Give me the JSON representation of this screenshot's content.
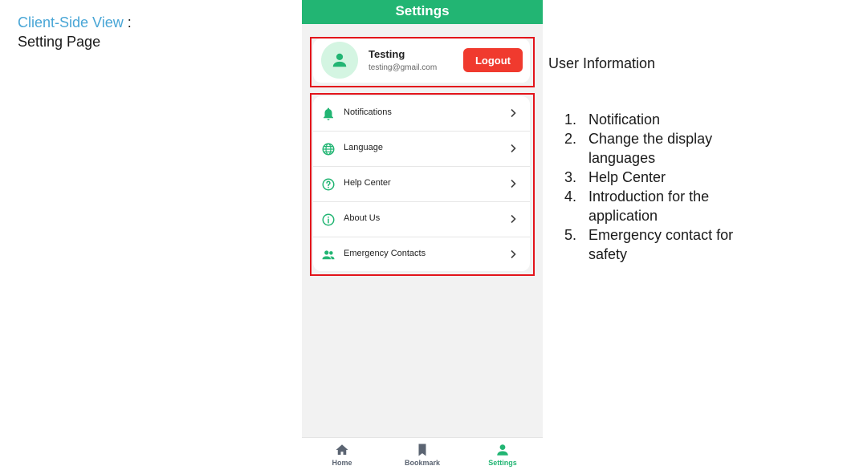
{
  "slide": {
    "title_accent": "Client-Side View",
    "title_colon": " :",
    "subtitle": "Setting Page"
  },
  "app": {
    "header_title": "Settings",
    "user": {
      "name": "Testing",
      "email": "testing@gmail.com",
      "logout_label": "Logout"
    },
    "menu": [
      {
        "label": "Notifications",
        "icon": "bell-icon"
      },
      {
        "label": "Language",
        "icon": "globe-icon"
      },
      {
        "label": "Help Center",
        "icon": "help-circle-icon"
      },
      {
        "label": "About Us",
        "icon": "info-icon"
      },
      {
        "label": "Emergency Contacts",
        "icon": "people-icon"
      }
    ],
    "tabs": [
      {
        "label": "Home",
        "icon": "home-icon",
        "active": false
      },
      {
        "label": "Bookmark",
        "icon": "bookmark-icon",
        "active": false
      },
      {
        "label": "Settings",
        "icon": "person-icon",
        "active": true
      }
    ]
  },
  "annotations": {
    "heading": "User Information",
    "list": [
      {
        "num": "1.",
        "text": "Notification"
      },
      {
        "num": "2.",
        "text": "Change the display languages"
      },
      {
        "num": "3.",
        "text": "Help Center"
      },
      {
        "num": "4.",
        "text": "Introduction for the application"
      },
      {
        "num": "5.",
        "text": "Emergency contact for safety"
      }
    ]
  },
  "colors": {
    "brand_green": "#22b573",
    "logout_red": "#f03a2e",
    "highlight_red": "#e3141b",
    "title_accent_blue": "#49a6d6"
  }
}
